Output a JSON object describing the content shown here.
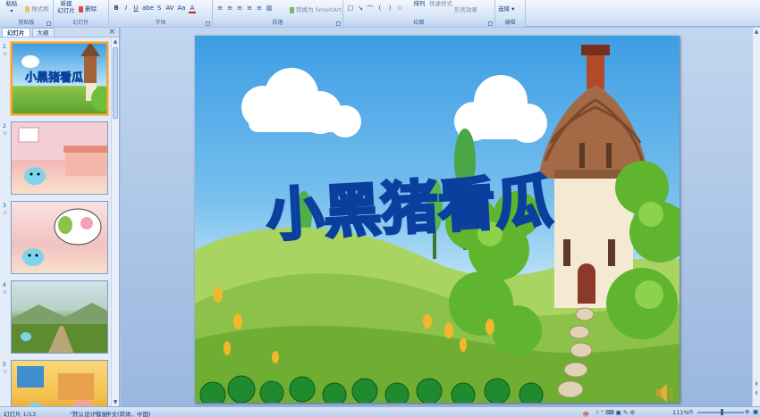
{
  "ribbon": {
    "clipboard": {
      "paste": "粘贴",
      "format_painter": "格式刷",
      "label": "剪贴板"
    },
    "slides": {
      "new_slide": "新建\n幻灯片",
      "delete": "删除",
      "label": "幻灯片"
    },
    "font": {
      "buttons": [
        "B",
        "I",
        "U",
        "abe",
        "S",
        "AV",
        "Aa",
        "A"
      ],
      "label": "字体"
    },
    "paragraph": {
      "convert_smartart": "转换为 SmartArt",
      "label": "段落"
    },
    "drawing": {
      "arrange": "排列",
      "quick_styles": "快速样式",
      "shape_effects": "形状效果",
      "label": "绘图"
    },
    "editing": {
      "select": "选择",
      "label": "编辑"
    }
  },
  "left_pane": {
    "tabs": [
      "幻灯片",
      "大纲"
    ],
    "close": "×",
    "thumbnails": [
      {
        "num": "1",
        "title": "小黑猪看瓜"
      },
      {
        "num": "2",
        "title": ""
      },
      {
        "num": "3",
        "title": ""
      },
      {
        "num": "4",
        "title": ""
      },
      {
        "num": "5",
        "title": ""
      }
    ]
  },
  "slide": {
    "title": "小黑猪看瓜",
    "sound_icon": "speaker-icon"
  },
  "status": {
    "slide_count": "幻灯片 1/13",
    "theme": "\"默认设计模板\"",
    "language": "中文(简体，中国)",
    "zoom": "111%",
    "ime": "中"
  },
  "colors": {
    "ribbon_bg": "#dbe8f8",
    "title_fill": "#1d7be0",
    "title_outline": "#0b3f9e",
    "sky": "#3d9de4"
  }
}
